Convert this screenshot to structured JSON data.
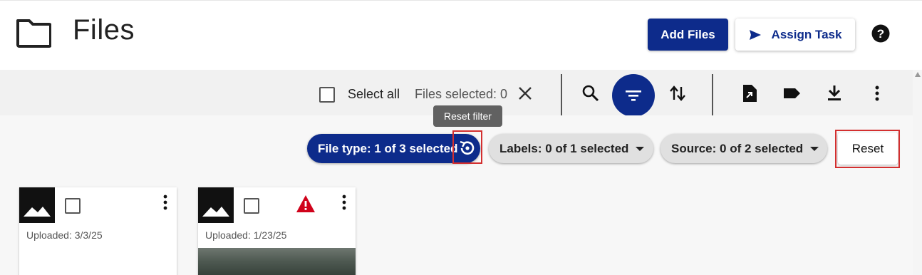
{
  "header": {
    "title": "Files",
    "add_files_label": "Add Files",
    "assign_task_label": "Assign Task"
  },
  "toolbar": {
    "select_all_label": "Select all",
    "files_selected_text": "Files selected: 0"
  },
  "tooltip": {
    "text": "Reset filter"
  },
  "filters": {
    "file_type_label": "File type: 1 of 3 selected",
    "labels_label": "Labels: 0 of 1 selected",
    "source_label": "Source: 0 of 2 selected",
    "reset_label": "Reset"
  },
  "cards": [
    {
      "uploaded": "Uploaded: 3/3/25",
      "warning": false
    },
    {
      "uploaded": "Uploaded: 1/23/25",
      "warning": true
    }
  ],
  "colors": {
    "primary": "#0d2b8b",
    "highlight": "#d32f2f",
    "warning": "#d0021b"
  },
  "icons": [
    "folder-icon",
    "send-icon",
    "help-icon",
    "search-icon",
    "filter-icon",
    "sort-icon",
    "file-export-icon",
    "label-icon",
    "download-icon",
    "more-vert-icon",
    "close-icon",
    "reset-filter-icon",
    "image-icon",
    "warning-icon"
  ]
}
